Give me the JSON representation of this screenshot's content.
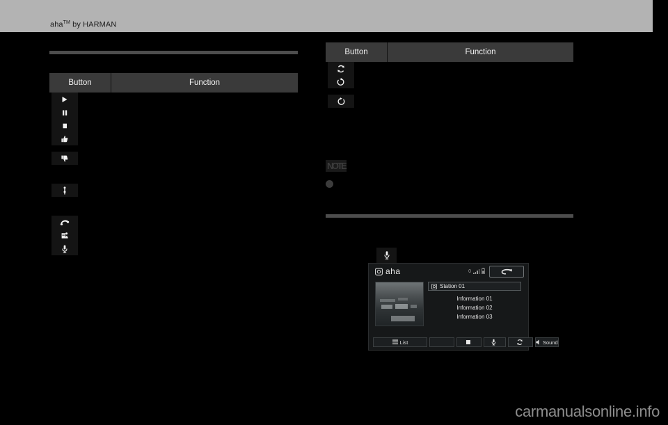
{
  "header": {
    "title_main": "aha",
    "title_sup": "TM",
    "title_rest": " by HARMAN"
  },
  "left_table": {
    "columns": [
      "Button",
      "Function"
    ],
    "rows": [
      {
        "icon": "play-icon",
        "glyph": "▶",
        "function": ""
      },
      {
        "icon": "pause-icon",
        "glyph": "▐▌",
        "function": ""
      },
      {
        "icon": "stop-icon",
        "glyph": "■",
        "function": ""
      },
      {
        "icon": "thumbs-up-icon",
        "glyph": "👍",
        "function": ""
      },
      {
        "icon": "thumbs-down-icon",
        "glyph": "👎",
        "function": ""
      },
      {
        "icon": "pin-location-icon",
        "glyph": "",
        "function": ""
      },
      {
        "icon": "phone-handset-icon",
        "glyph": "",
        "function": ""
      },
      {
        "icon": "share-person-icon",
        "glyph": "",
        "function": ""
      },
      {
        "icon": "microphone-icon",
        "glyph": "",
        "function": ""
      }
    ]
  },
  "right_table": {
    "columns": [
      "Button",
      "Function"
    ],
    "rows": [
      {
        "icon": "refresh-sync-icon",
        "function": ""
      },
      {
        "icon": "rewind-counterclockwise-icon",
        "function": ""
      },
      {
        "icon": "forward-clockwise-icon",
        "function": ""
      }
    ]
  },
  "note": {
    "title": "NOTE",
    "bullet_text": ""
  },
  "head_unit": {
    "brand": "aha",
    "signal_count": "0",
    "back_label": "",
    "station": "Station 01",
    "info_lines": [
      "Information 01",
      "Information 02",
      "Information 03"
    ],
    "bottom_buttons": [
      {
        "name": "list-button",
        "label": "List"
      },
      {
        "name": "blank-button",
        "label": ""
      },
      {
        "name": "stop-button",
        "label": ""
      },
      {
        "name": "mic-button",
        "label": ""
      },
      {
        "name": "sync-button",
        "label": ""
      },
      {
        "name": "sound-button",
        "label": "Sound"
      }
    ]
  },
  "footer": {
    "watermark": "carmanualsonline.info"
  },
  "colors": {
    "page_background": "#000000",
    "header_band": "#b3b3b3",
    "table_header": "#3a3a3a",
    "rule": "#4d4d4d",
    "keycap": "#141414",
    "text_light": "#f2f2f2",
    "watermark": "#8d8d8d"
  }
}
